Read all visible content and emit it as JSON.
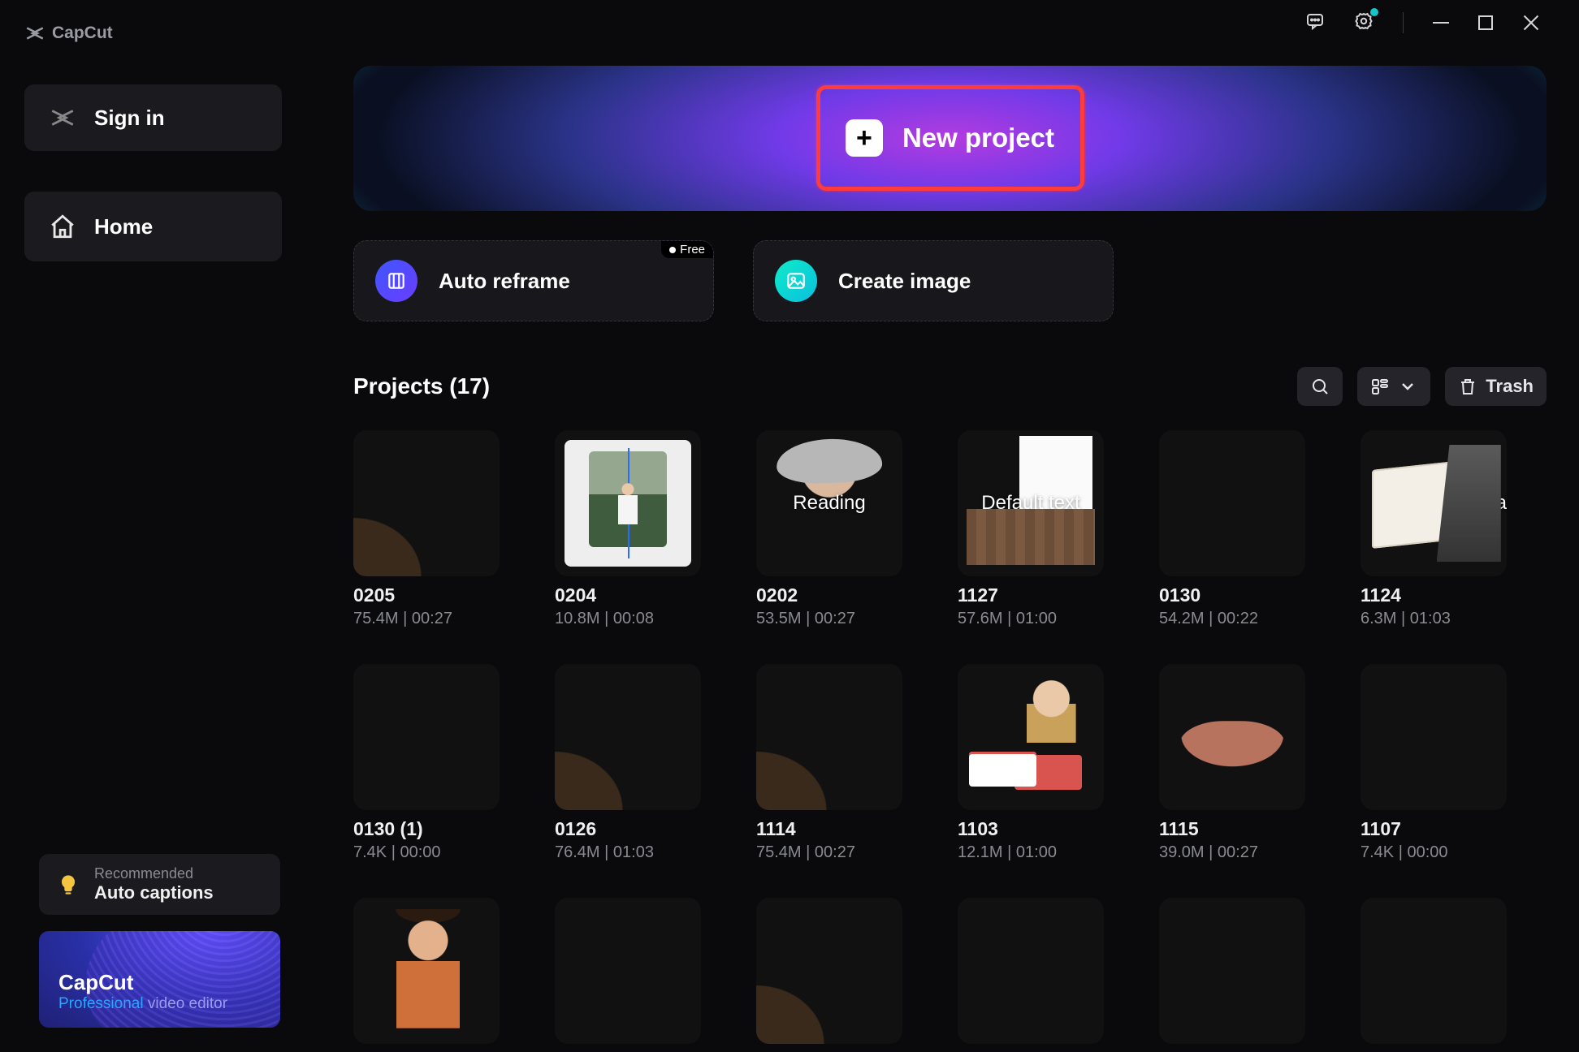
{
  "app": {
    "name": "CapCut"
  },
  "sidebar": {
    "signin_label": "Sign in",
    "nav": {
      "home": "Home"
    },
    "recommended": {
      "label": "Recommended",
      "feature": "Auto captions"
    },
    "promo": {
      "title": "CapCut",
      "sub_blue": "Professional",
      "sub_rest": " video editor"
    }
  },
  "hero": {
    "new_project_label": "New project"
  },
  "tiles": {
    "auto_reframe": "Auto reframe",
    "free_badge": "Free",
    "create_image": "Create image"
  },
  "projects": {
    "title": "Projects  (17)",
    "trash": "Trash",
    "items": [
      {
        "name": "0205",
        "meta": "75.4M | 00:27",
        "thumb": "t-cliff",
        "overlay": ""
      },
      {
        "name": "0204",
        "meta": "10.8M | 00:08",
        "thumb": "t-editor",
        "overlay": ""
      },
      {
        "name": "0202",
        "meta": "53.5M | 00:27",
        "thumb": "t-suit",
        "overlay": "Reading"
      },
      {
        "name": "1127",
        "meta": "57.6M | 01:00",
        "thumb": "t-room",
        "overlay": "Default text"
      },
      {
        "name": "0130",
        "meta": "54.2M | 00:22",
        "thumb": "t-waves",
        "overlay": ""
      },
      {
        "name": "1124",
        "meta": "6.3M | 01:03",
        "thumb": "t-book",
        "overlay": "rea"
      },
      {
        "name": "0130 (1)",
        "meta": "7.4K | 00:00",
        "thumb": "t-black",
        "overlay": ""
      },
      {
        "name": "0126",
        "meta": "76.4M | 01:03",
        "thumb": "t-cliff",
        "overlay": ""
      },
      {
        "name": "1114",
        "meta": "75.4M | 00:27",
        "thumb": "t-cliff2",
        "overlay": ""
      },
      {
        "name": "1103",
        "meta": "12.1M | 01:00",
        "thumb": "t-desk",
        "overlay": ""
      },
      {
        "name": "1115",
        "meta": "39.0M | 00:27",
        "thumb": "t-lips",
        "overlay": ""
      },
      {
        "name": "1107",
        "meta": "7.4K | 00:00",
        "thumb": "t-black",
        "overlay": ""
      },
      {
        "name": "",
        "meta": "",
        "thumb": "t-green",
        "overlay": ""
      },
      {
        "name": "",
        "meta": "",
        "thumb": "t-black",
        "overlay": ""
      },
      {
        "name": "",
        "meta": "",
        "thumb": "t-cliff",
        "overlay": ""
      },
      {
        "name": "",
        "meta": "",
        "thumb": "t-black",
        "overlay": ""
      },
      {
        "name": "",
        "meta": "",
        "thumb": "t-black",
        "overlay": ""
      },
      {
        "name": "",
        "meta": "",
        "thumb": "t-black",
        "overlay": ""
      }
    ]
  }
}
